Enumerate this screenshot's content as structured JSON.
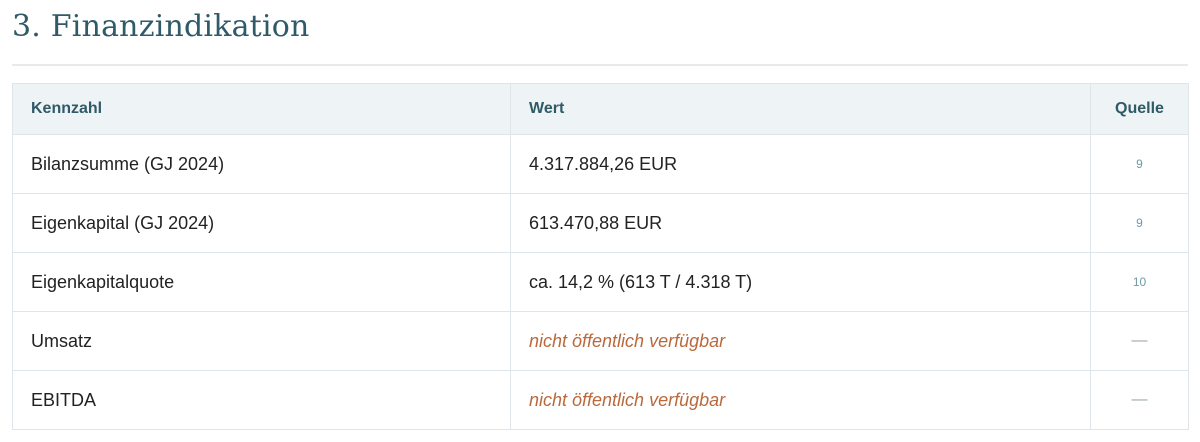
{
  "section": {
    "title": "3. Finanzindikation"
  },
  "table": {
    "headers": {
      "metric": "Kennzahl",
      "value": "Wert",
      "source": "Quelle"
    },
    "rows": [
      {
        "metric": "Bilanzsumme (GJ 2024)",
        "value": "4.317.884,26 EUR",
        "source": "9"
      },
      {
        "metric": "Eigenkapital (GJ 2024)",
        "value": "613.470,88 EUR",
        "source": "9"
      },
      {
        "metric": "Eigenkapitalquote",
        "value": "ca. 14,2 % (613 T / 4.318 T)",
        "source": "10"
      },
      {
        "metric": "Umsatz",
        "value": "nicht öffentlich verfügbar",
        "source": "—"
      },
      {
        "metric": "EBITDA",
        "value": "nicht öffentlich verfügbar",
        "source": "—"
      }
    ]
  },
  "colors": {
    "heading": "#2f5a68",
    "header_bg": "#eef3f5",
    "unavailable_text": "#b9693c",
    "source_link": "#6f9aa8"
  }
}
